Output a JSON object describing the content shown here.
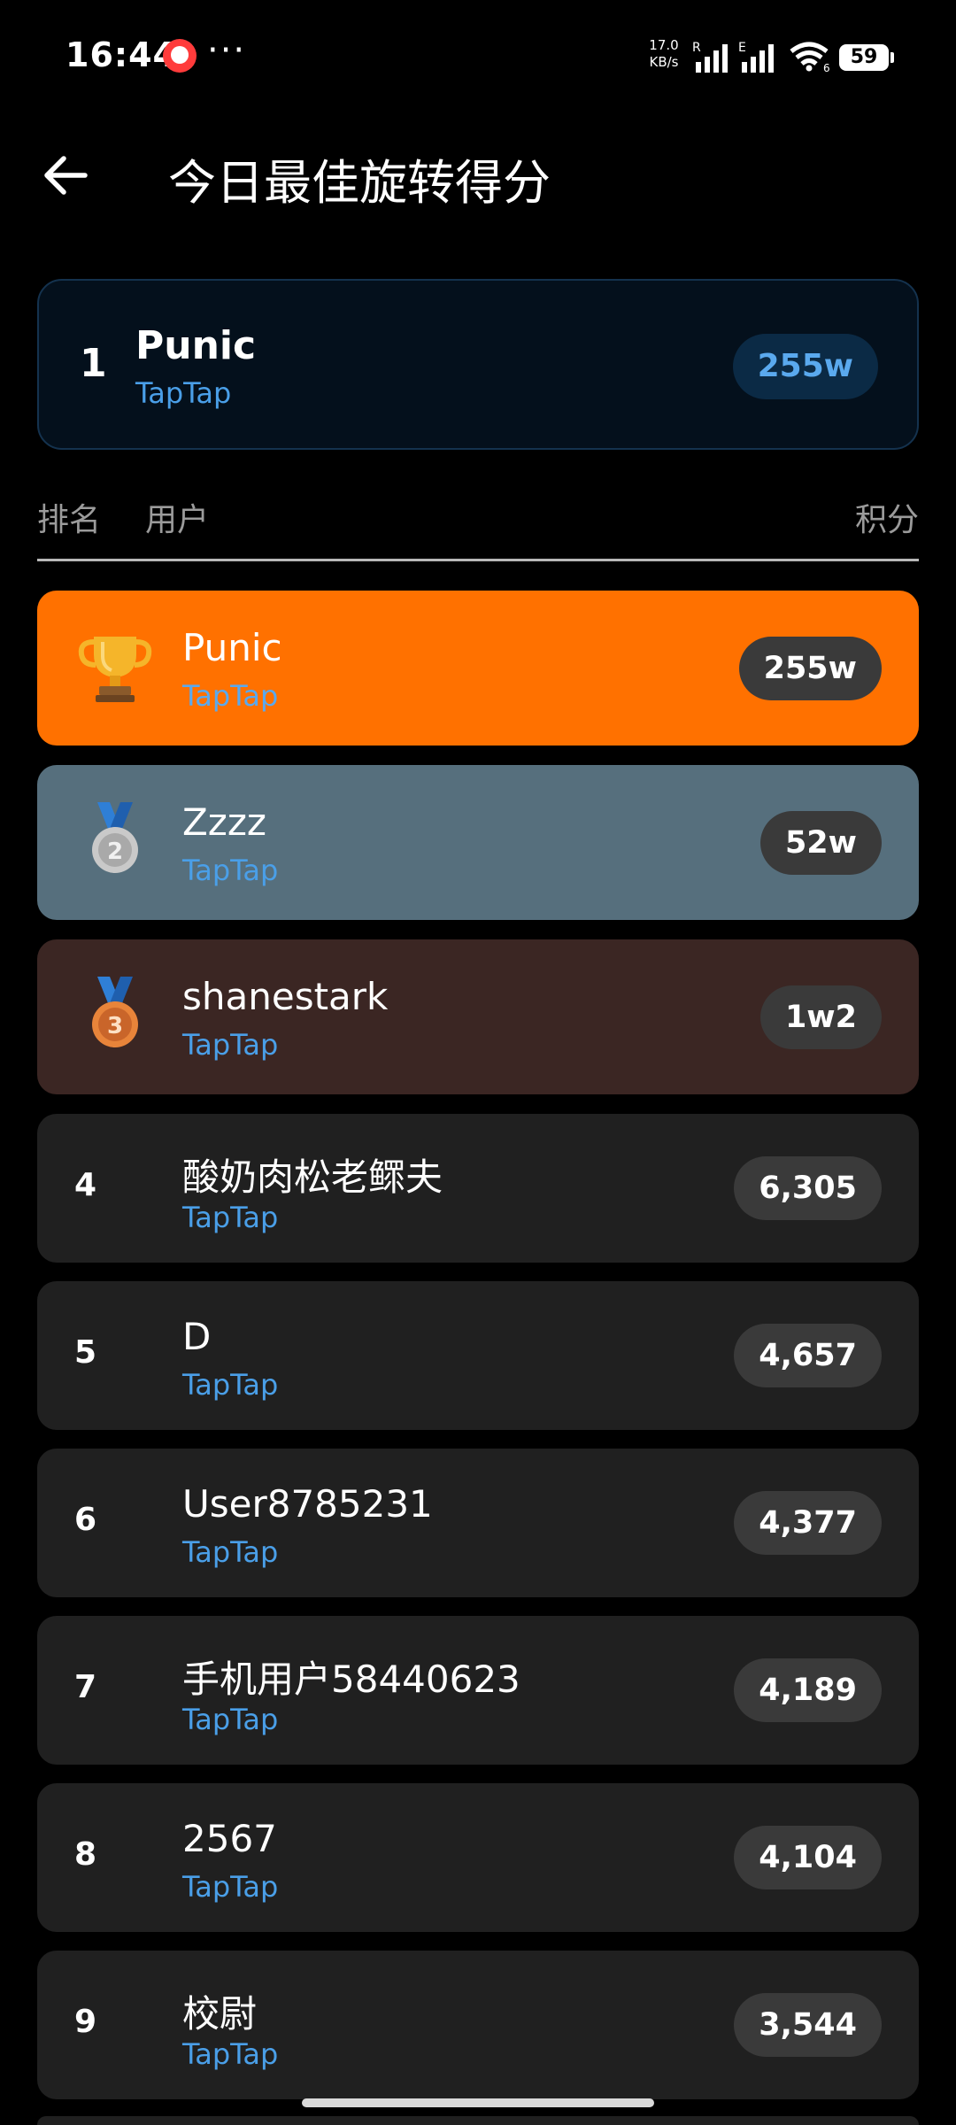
{
  "status_bar": {
    "time": "16:44",
    "dots": "···",
    "net_speed_value": "17.0",
    "net_speed_unit": "KB/s",
    "signal1_tag": "R",
    "signal2_tag": "E",
    "wifi_tag": "6",
    "battery": "59",
    "icons": [
      "notification-app-icon",
      "signal-icon",
      "signal-icon",
      "wifi-icon",
      "battery-icon"
    ]
  },
  "header": {
    "title": "今日最佳旋转得分",
    "back_icon": "arrow-left-icon"
  },
  "my_rank": {
    "rank": "1",
    "name": "Punic",
    "platform": "TapTap",
    "score": "255w"
  },
  "columns": {
    "rank": "排名",
    "user": "用户",
    "score": "积分"
  },
  "leaderboard": [
    {
      "rank": "1",
      "medal": "trophy-icon",
      "name": "Punic",
      "platform": "TapTap",
      "score": "255w"
    },
    {
      "rank": "2",
      "medal": "silver-medal-icon",
      "name": "Zzzz",
      "platform": "TapTap",
      "score": "52w"
    },
    {
      "rank": "3",
      "medal": "bronze-medal-icon",
      "name": "shanestark",
      "platform": "TapTap",
      "score": "1w2"
    },
    {
      "rank": "4",
      "name": "酸奶肉松老鳏夫",
      "platform": "TapTap",
      "score": "6,305"
    },
    {
      "rank": "5",
      "name": "D",
      "platform": "TapTap",
      "score": "4,657"
    },
    {
      "rank": "6",
      "name": "User8785231",
      "platform": "TapTap",
      "score": "4,377"
    },
    {
      "rank": "7",
      "name": "手机用户58440623",
      "platform": "TapTap",
      "score": "4,189"
    },
    {
      "rank": "8",
      "name": "2567",
      "platform": "TapTap",
      "score": "4,104"
    },
    {
      "rank": "9",
      "name": "校尉",
      "platform": "TapTap",
      "score": "3,544"
    }
  ],
  "colors": {
    "gold_row": "#ff7100",
    "silver_row": "#566f7d",
    "bronze_row": "#3b2623",
    "row": "#202020",
    "link": "#4a9fe8"
  }
}
